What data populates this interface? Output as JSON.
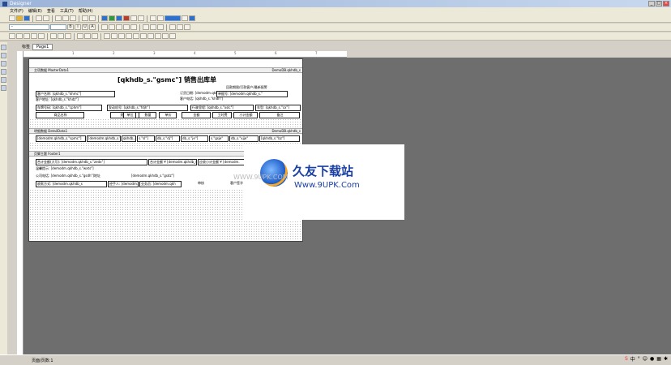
{
  "window": {
    "title": "Designer"
  },
  "menu": [
    {
      "label": "文件(F)"
    },
    {
      "label": "编辑(E)"
    },
    {
      "label": "查看"
    },
    {
      "label": "工具(T)"
    },
    {
      "label": "帮助(H)"
    }
  ],
  "toolbar2": {
    "combo_value": "-"
  },
  "sheet": {
    "label": "标签",
    "tab": "Page1"
  },
  "ruler": [
    "1",
    "2",
    "3",
    "4",
    "5",
    "6",
    "7",
    "8"
  ],
  "report": {
    "masterdata_band": "主项数据 MasterData1",
    "masterdata_right": "DemoDB.qkhdb_s",
    "title": "[qkhdb_s.\"gsmc\"] 销售出库单",
    "master_fields": [
      "客户名称: [qkhdb_s.\"khmc\"]",
      "订货日期: [demodm.qkhdb_",
      "客户地址: [qkhdb_s.\"khdz\"]",
      "客户电话: [qkhdb_s.\"khdh\"]",
      "车牌号码: [qkhdb_s.\"cphm\"]",
      "发动机号: [qkhdb_s.\"fdjh\"]",
      "行驶里程: [qkhdb_s.\"xslc\"]",
      "车型: [qkhdb_s.\"cx\"]",
      "回款期限/打款客户/最新报警",
      "单据号: [demodm.qkhdb_s.\""
    ],
    "columns": [
      "商品名称",
      "规格型号",
      "单位",
      "数量",
      "单价",
      "金额",
      "工时费",
      "小计金额",
      "备注"
    ],
    "detail_band": "明细数据 DetailData1",
    "detail_right": "DemoDB.qkhdb_s",
    "detail_fields": [
      "[demodm.qkhdb_s.\"spmc\"]",
      "[demodm.qkhdb_s.\"ggxh",
      "qkhdb_s.\"d",
      "s.\"sl\"]",
      "db_s.\"dj\"]",
      "db_s.\"je\"]",
      "s.\"gsje\"",
      "db_s.\"xjje\"",
      "[qkhdb_s.\"bz\"]"
    ],
    "footer_band": "页脚主题 Footer1",
    "footer_fields": [
      "合计金额(大写): [demodm.qkhdb_s.\"zedx\"]",
      "合计金额 ¥ [demodm.qkhdb_s.",
      "应收小计金额 ¥ [demodm.",
      "温馨提示: [demodm.qkhdb_s.\"wxts\"]",
      "公司电话: [demodm.qkhdb_s.\"gsdh\"]地址",
      "[demodm.qkhdb_s.\"gsdz\"]",
      "收款方式: [demodm.qkhdb_s",
      "经手人: [demodm.qkh",
      "业务员: [demodm.qkh",
      "审核",
      "客户签字"
    ]
  },
  "watermark": {
    "title": "久友下载站",
    "url": "Www.9UPK.Com",
    "ghost": "WWW.9UPK.COM"
  },
  "status": {
    "text": "页面/页数:1"
  },
  "colors": {
    "canvas": "#6e6e6e",
    "paper": "#ffffff",
    "brand": "#1a3fa3"
  }
}
